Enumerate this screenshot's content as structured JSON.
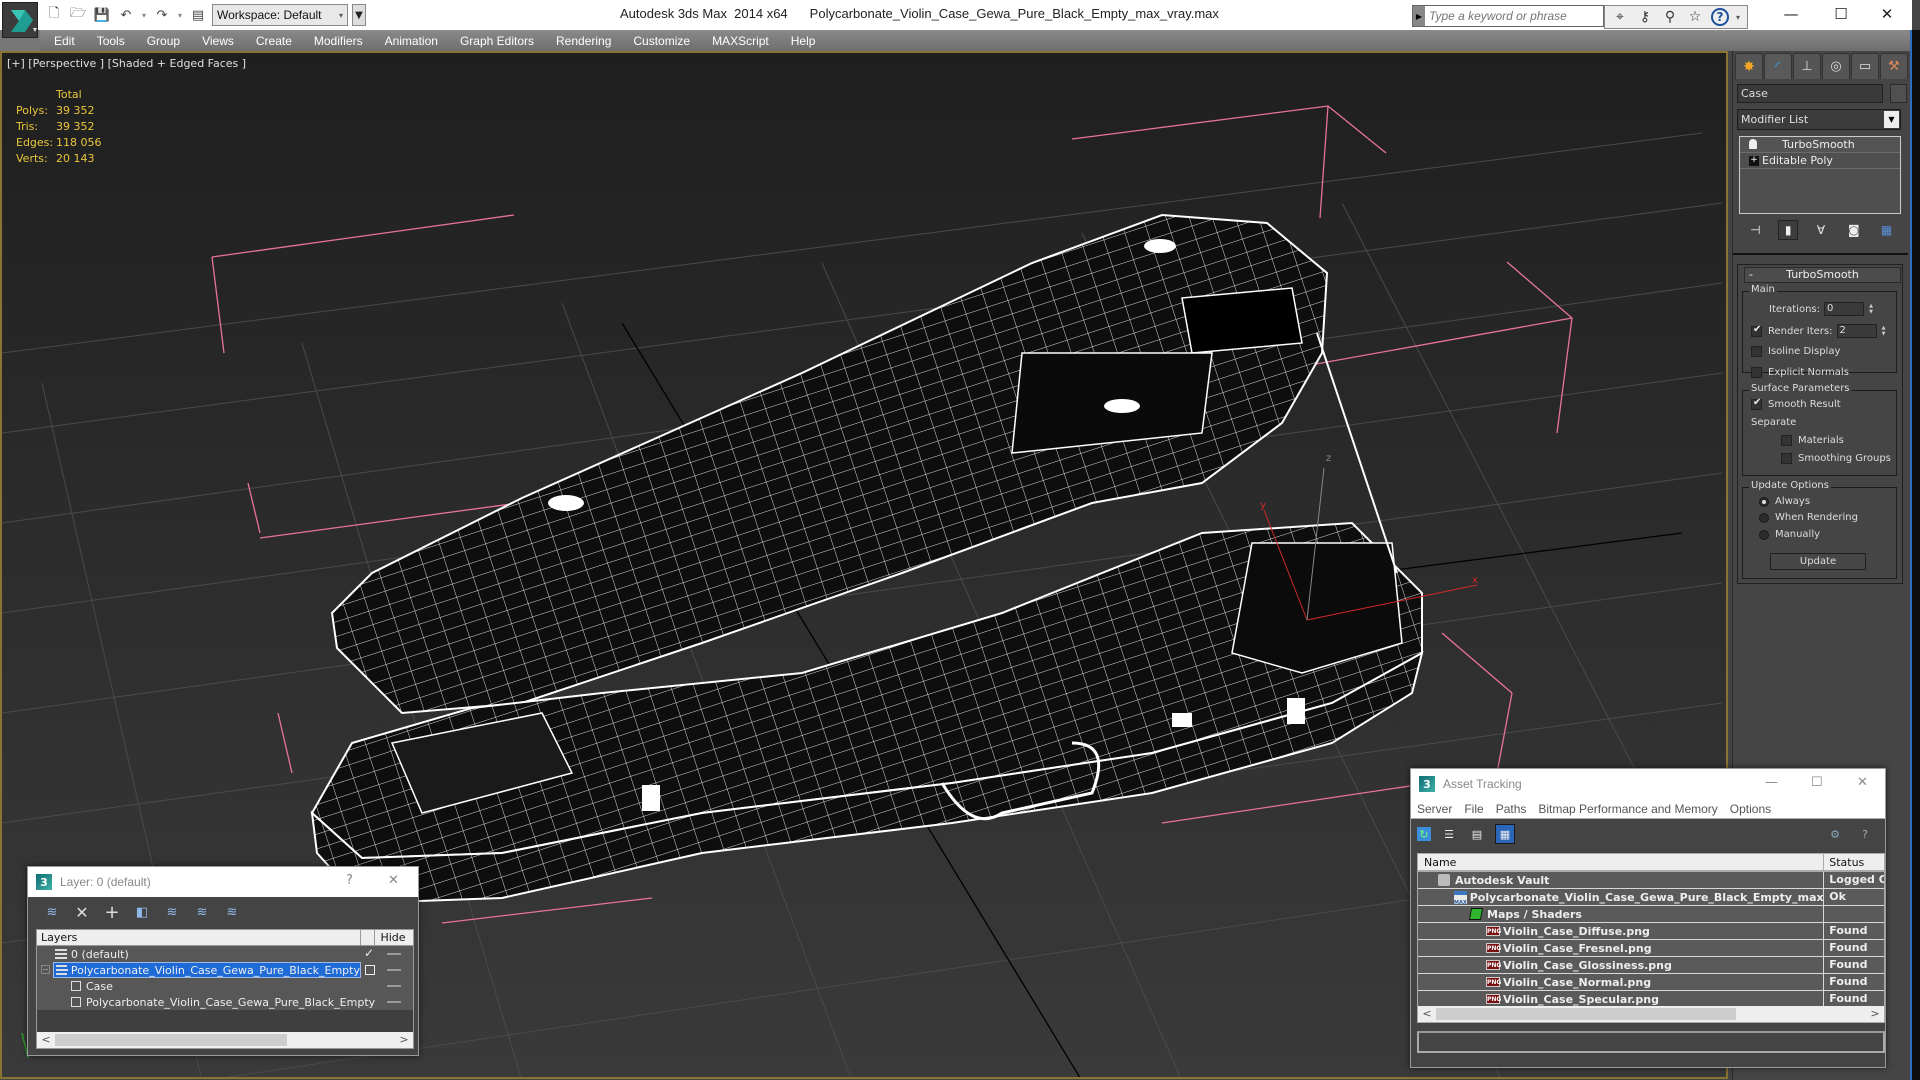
{
  "window": {
    "app_title": "Autodesk 3ds Max  2014 x64",
    "file_title": "Polycarbonate_Violin_Case_Gewa_Pure_Black_Empty_max_vray.max",
    "workspace": "Workspace: Default",
    "search_placeholder": "Type a keyword or phrase",
    "controls": {
      "minimize": "—",
      "maximize": "☐",
      "close": "✕"
    }
  },
  "quick_access": [
    "new-icon",
    "open-icon",
    "save-icon",
    "undo-icon",
    "redo-icon",
    "project-icon"
  ],
  "menu": [
    "Edit",
    "Tools",
    "Group",
    "Views",
    "Create",
    "Modifiers",
    "Animation",
    "Graph Editors",
    "Rendering",
    "Customize",
    "MAXScript",
    "Help"
  ],
  "info_center": [
    "binoculars-icon",
    "key-icon",
    "satellite-icon",
    "star-icon",
    "help-icon"
  ],
  "viewport": {
    "label": "[+] [Perspective ] [Shaded + Edged Faces ]",
    "stats": {
      "header": "Total",
      "rows": [
        {
          "label": "Polys:",
          "value": "39 352"
        },
        {
          "label": "Tris:",
          "value": "39 352"
        },
        {
          "label": "Edges:",
          "value": "118 056"
        },
        {
          "label": "Verts:",
          "value": "20 143"
        }
      ]
    },
    "gizmo_axes": {
      "x": "x",
      "y": "y",
      "z": "z"
    },
    "colors": {
      "background": "#232323",
      "grid": "#4a4a4a",
      "wire": "#ffffff",
      "selection_bracket": "#e8739a",
      "border": "#8a7434"
    }
  },
  "command_panel": {
    "tabs": [
      "create-icon",
      "modify-icon",
      "hierarchy-icon",
      "motion-icon",
      "display-icon",
      "utilities-icon"
    ],
    "object_name": "Case",
    "modifier_list": "Modifier List",
    "stack": [
      {
        "name": "TurboSmooth",
        "selected": true
      },
      {
        "name": "Editable Poly",
        "selected": false
      }
    ],
    "rollout": {
      "title": "TurboSmooth",
      "collapse": "-",
      "main_label": "Main",
      "iterations_label": "Iterations:",
      "iterations_value": "0",
      "render_iters_label": "Render Iters:",
      "render_iters_value": "2",
      "render_iters_checked": true,
      "isoline_display": "Isoline Display",
      "explicit_normals": "Explicit Normals",
      "surface_params_label": "Surface Parameters",
      "smooth_result": "Smooth Result",
      "separate_label": "Separate",
      "materials": "Materials",
      "smoothing_groups": "Smoothing Groups",
      "update_options_label": "Update Options",
      "always": "Always",
      "when_rendering": "When Rendering",
      "manually": "Manually",
      "update_button": "Update"
    }
  },
  "layer_dialog": {
    "title": "Layer: 0 (default)",
    "help": "?",
    "close": "✕",
    "columns": {
      "layers": "Layers",
      "hide": "Hide"
    },
    "rows": [
      {
        "name": "0 (default)",
        "type": "layer",
        "current": true
      },
      {
        "name": "Polycarbonate_Violin_Case_Gewa_Pure_Black_Empty",
        "type": "layer",
        "selected": true
      },
      {
        "name": "Case",
        "type": "object"
      },
      {
        "name": "Polycarbonate_Violin_Case_Gewa_Pure_Black_Empty",
        "type": "object"
      }
    ],
    "scroll_left": "<",
    "scroll_right": ">"
  },
  "asset_dialog": {
    "title": "Asset Tracking",
    "menu": [
      "Server",
      "File",
      "Paths",
      "Bitmap Performance and Memory",
      "Options"
    ],
    "columns": {
      "name": "Name",
      "status": "Status"
    },
    "rows": [
      {
        "name": "Autodesk Vault",
        "status": "Logged O",
        "icon": "vault"
      },
      {
        "name": "Polycarbonate_Violin_Case_Gewa_Pure_Black_Empty_max_vray.m...",
        "status": "Ok",
        "icon": "max"
      },
      {
        "name": "Maps / Shaders",
        "status": "",
        "icon": "maps"
      },
      {
        "name": "Violin_Case_Diffuse.png",
        "status": "Found",
        "icon": "png"
      },
      {
        "name": "Violin_Case_Fresnel.png",
        "status": "Found",
        "icon": "png"
      },
      {
        "name": "Violin_Case_Glossiness.png",
        "status": "Found",
        "icon": "png"
      },
      {
        "name": "Violin_Case_Normal.png",
        "status": "Found",
        "icon": "png"
      },
      {
        "name": "Violin_Case_Specular.png",
        "status": "Found",
        "icon": "png"
      }
    ],
    "png_badge": "PNG",
    "max_badge": "MAX",
    "scroll_left": "<",
    "scroll_right": ">"
  }
}
